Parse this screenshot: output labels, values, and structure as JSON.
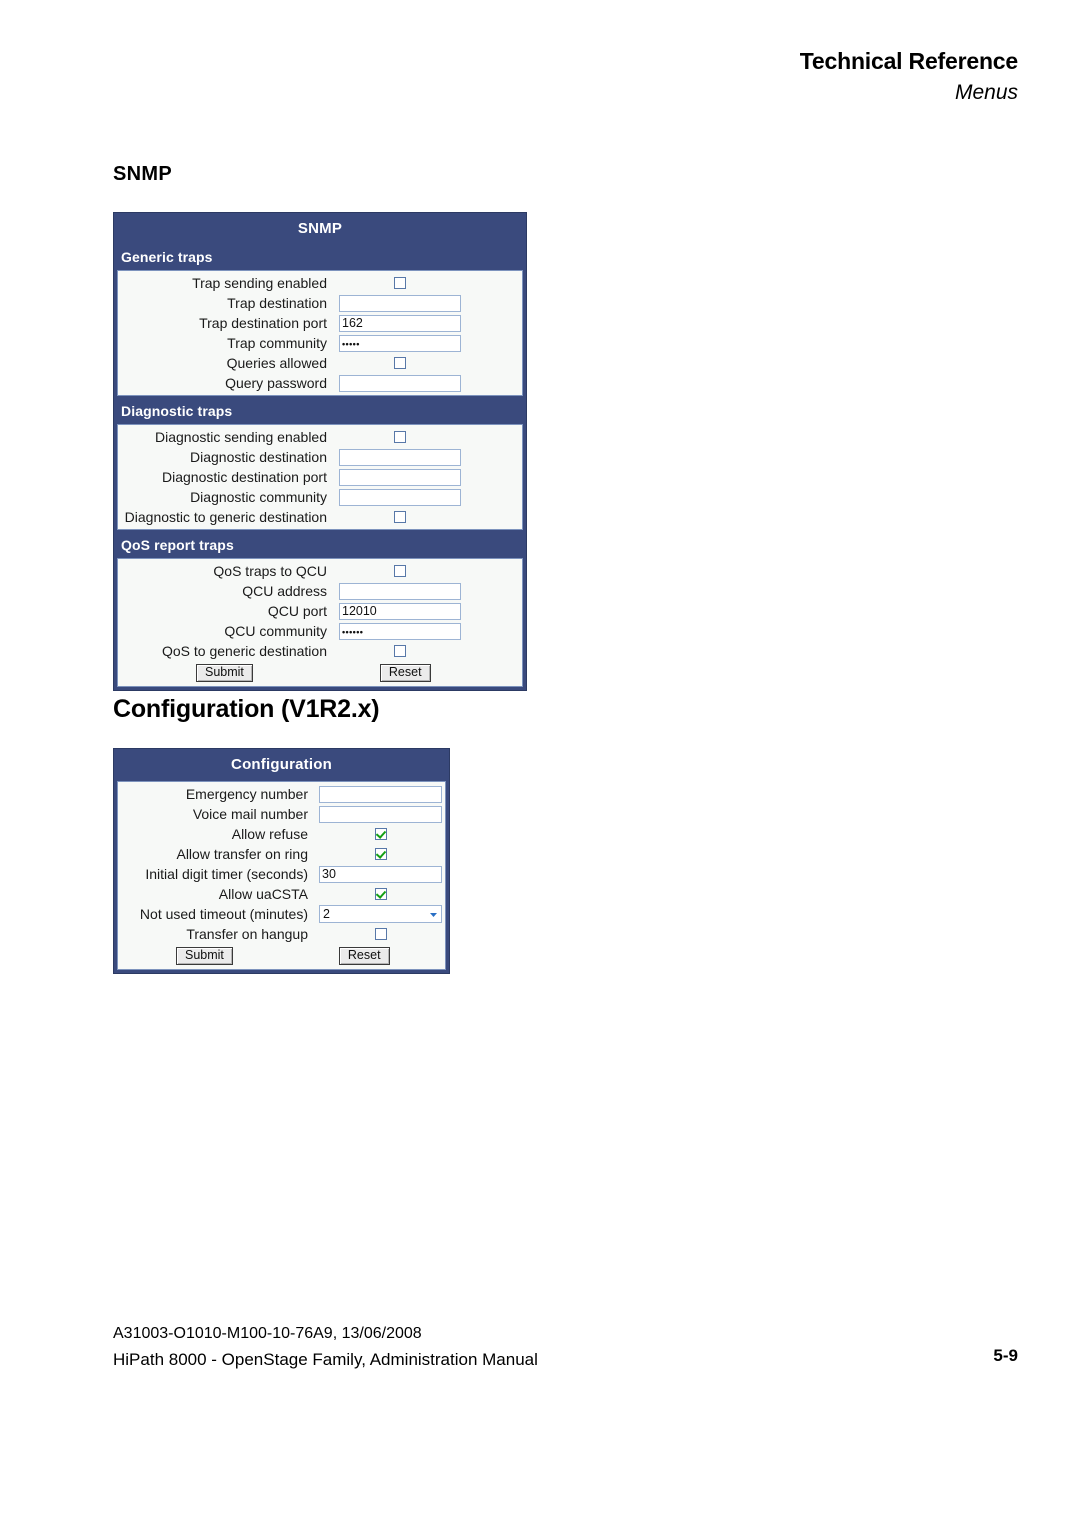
{
  "header": {
    "title": "Technical Reference",
    "subtitle": "Menus"
  },
  "headings": {
    "snmp": "SNMP",
    "configuration": "Configuration (V1R2.x)"
  },
  "colors": {
    "panel_header": "#3a4a7d",
    "panel_body": "#f7f9f7",
    "input_border": "#9db4d4",
    "check_green": "#13a015"
  },
  "snmp_panel": {
    "title": "SNMP",
    "groups": [
      {
        "title": "Generic traps",
        "rows": [
          {
            "label": "Trap sending enabled",
            "type": "checkbox",
            "checked": false
          },
          {
            "label": "Trap destination",
            "type": "text",
            "value": ""
          },
          {
            "label": "Trap destination port",
            "type": "text",
            "value": "162"
          },
          {
            "label": "Trap community",
            "type": "password",
            "value": "•••••"
          },
          {
            "label": "Queries allowed",
            "type": "checkbox",
            "checked": false
          },
          {
            "label": "Query password",
            "type": "text",
            "value": ""
          }
        ]
      },
      {
        "title": "Diagnostic traps",
        "rows": [
          {
            "label": "Diagnostic sending enabled",
            "type": "checkbox",
            "checked": false
          },
          {
            "label": "Diagnostic destination",
            "type": "text",
            "value": ""
          },
          {
            "label": "Diagnostic destination port",
            "type": "text",
            "value": ""
          },
          {
            "label": "Diagnostic community",
            "type": "text",
            "value": ""
          },
          {
            "label": "Diagnostic to generic destination",
            "type": "checkbox",
            "checked": false
          }
        ]
      },
      {
        "title": "QoS report traps",
        "rows": [
          {
            "label": "QoS traps to QCU",
            "type": "checkbox",
            "checked": false
          },
          {
            "label": "QCU address",
            "type": "text",
            "value": ""
          },
          {
            "label": "QCU port",
            "type": "text",
            "value": "12010"
          },
          {
            "label": "QCU community",
            "type": "password",
            "value": "••••••"
          },
          {
            "label": "QoS to generic destination",
            "type": "checkbox",
            "checked": false
          }
        ],
        "submit_label": "Submit",
        "reset_label": "Reset"
      }
    ]
  },
  "config_panel": {
    "title": "Configuration",
    "rows": [
      {
        "label": "Emergency number",
        "type": "text",
        "value": ""
      },
      {
        "label": "Voice mail number",
        "type": "text",
        "value": ""
      },
      {
        "label": "Allow refuse",
        "type": "checkbox",
        "checked": true
      },
      {
        "label": "Allow transfer on ring",
        "type": "checkbox",
        "checked": true
      },
      {
        "label": "Initial digit timer (seconds)",
        "type": "text",
        "value": "30"
      },
      {
        "label": "Allow uaCSTA",
        "type": "checkbox",
        "checked": true
      },
      {
        "label": "Not used timeout (minutes)",
        "type": "select",
        "value": "2",
        "icon": "chevron-down-icon"
      },
      {
        "label": "Transfer on hangup",
        "type": "checkbox",
        "checked": false
      }
    ],
    "submit_label": "Submit",
    "reset_label": "Reset"
  },
  "footer": {
    "line1": "A31003-O1010-M100-10-76A9, 13/06/2008",
    "line2": "HiPath 8000 - OpenStage Family, Administration Manual",
    "page": "5-9"
  }
}
